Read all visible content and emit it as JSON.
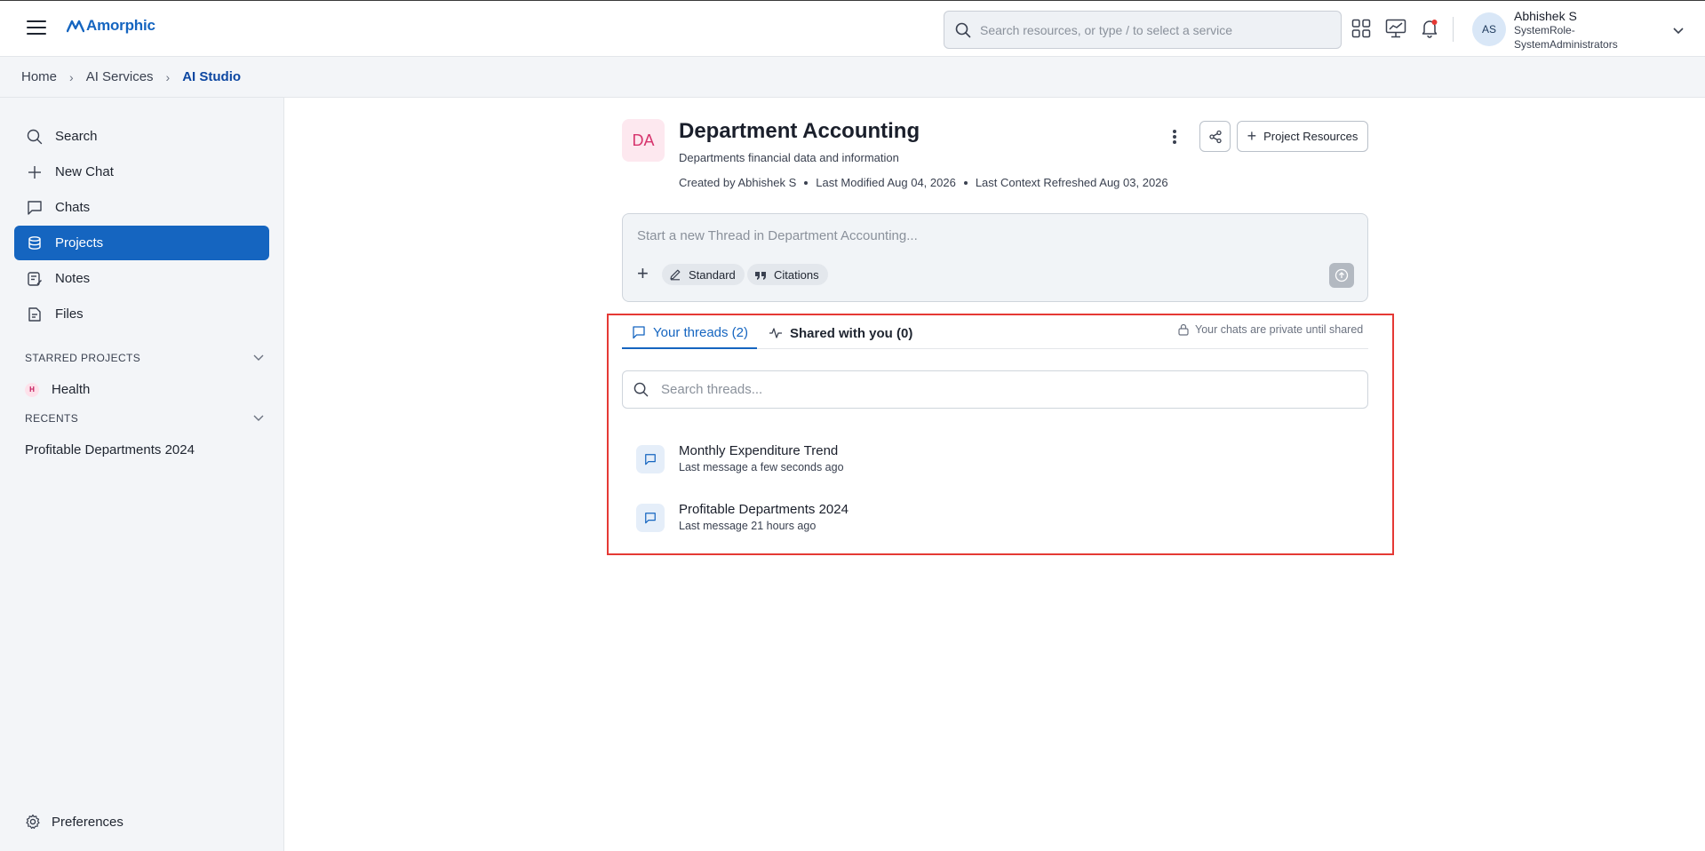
{
  "app": {
    "logo_text": "Amorphic",
    "search_placeholder": "Search resources, or type / to select a service"
  },
  "user": {
    "initials": "AS",
    "name": "Abhishek S",
    "role_line1": "SystemRole-",
    "role_line2": "SystemAdministrators"
  },
  "breadcrumb": [
    "Home",
    "AI Services",
    "AI Studio"
  ],
  "sidebar": {
    "items": [
      {
        "label": "Search",
        "icon": "search-icon"
      },
      {
        "label": "New Chat",
        "icon": "plus-icon"
      },
      {
        "label": "Chats",
        "icon": "chat-bubble-icon"
      },
      {
        "label": "Projects",
        "icon": "projects-icon",
        "active": true
      },
      {
        "label": "Notes",
        "icon": "notes-icon"
      },
      {
        "label": "Files",
        "icon": "file-icon"
      }
    ],
    "starred_heading": "STARRED PROJECTS",
    "starred": [
      {
        "badge": "H",
        "label": "Health"
      }
    ],
    "recents_heading": "RECENTS",
    "recents": [
      "Profitable Departments 2024"
    ],
    "preferences_label": "Preferences"
  },
  "project": {
    "initials": "DA",
    "title": "Department Accounting",
    "description": "Departments financial data and information",
    "created_by": "Created by Abhishek S",
    "last_modified": "Last Modified Aug 04, 2026",
    "last_context_refreshed": "Last Context Refreshed Aug 03, 2026",
    "resources_label": "Project Resources"
  },
  "composer": {
    "placeholder": "Start a new Thread in Department Accounting...",
    "chip_standard": "Standard",
    "chip_citations": "Citations"
  },
  "threads": {
    "tab_yours": "Your threads (2)",
    "tab_shared": "Shared with you (0)",
    "privacy_note": "Your chats are private until shared",
    "search_placeholder": "Search threads...",
    "items": [
      {
        "title": "Monthly Expenditure Trend",
        "subtitle": "Last message a few seconds ago"
      },
      {
        "title": "Profitable Departments 2024",
        "subtitle": "Last message 21 hours ago"
      }
    ]
  },
  "colors": {
    "accent": "#1565c0",
    "highlight": "#e53935",
    "project_avatar": "#d6336c"
  }
}
